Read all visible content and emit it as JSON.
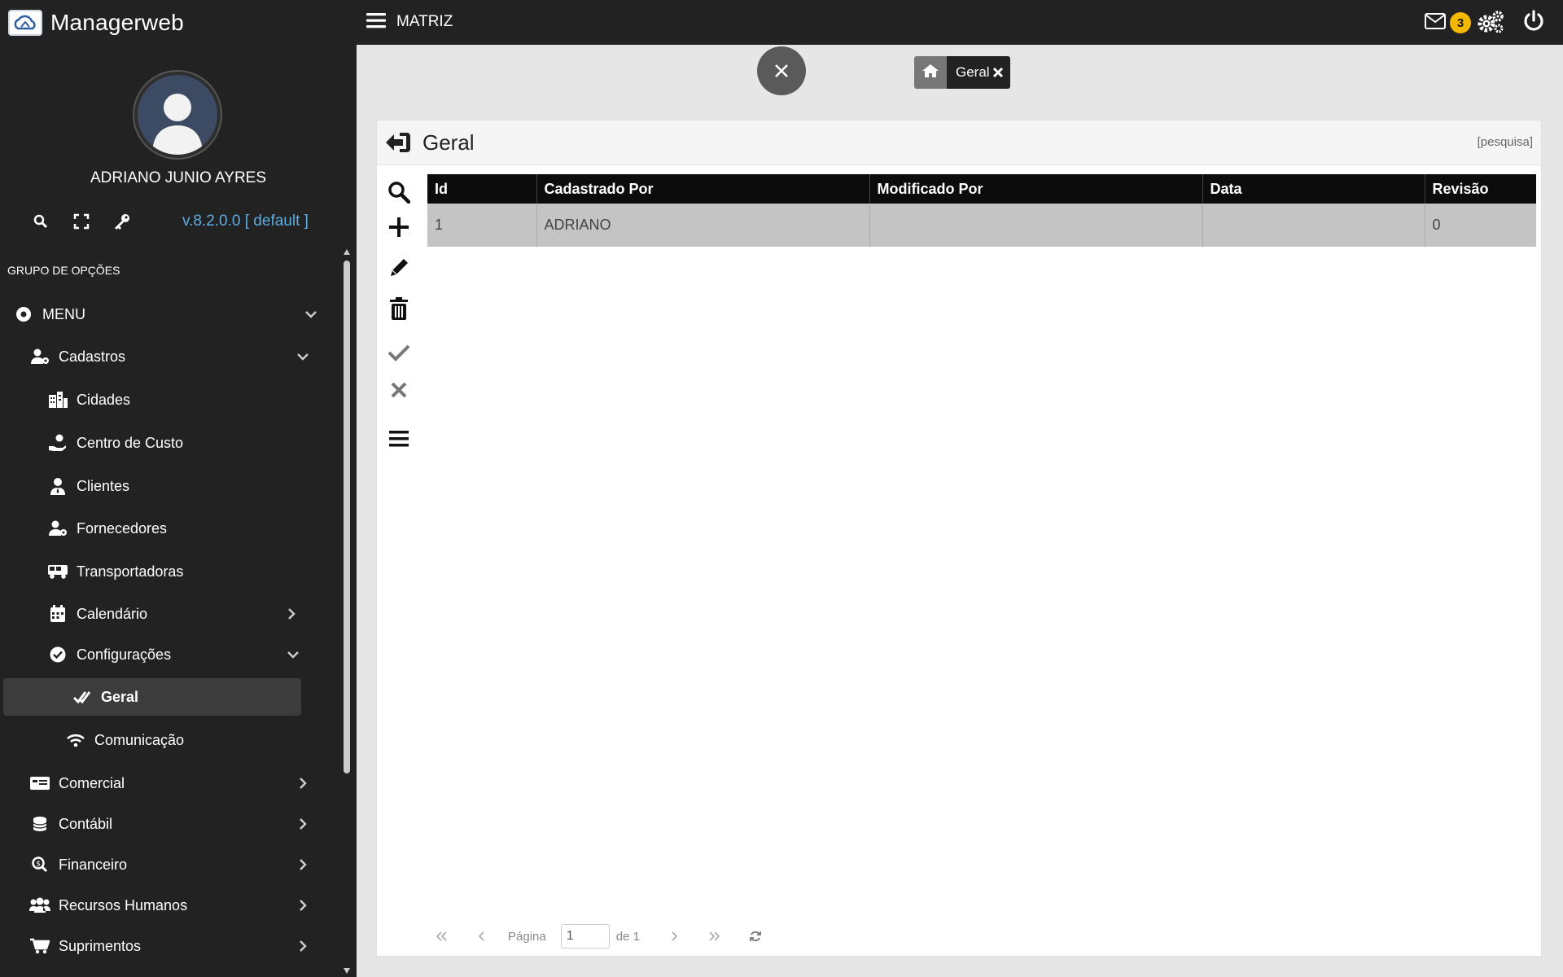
{
  "app": {
    "title": "Managerweb",
    "company": "MATRIZ",
    "version": "v.8.2.0.0 [ default ]"
  },
  "user": {
    "name": "ADRIANO JUNIO AYRES"
  },
  "notifications": {
    "mail_count": "3"
  },
  "sidebar": {
    "group_label": "GRUPO DE OPÇÕES",
    "items": [
      {
        "label": "MENU",
        "icon": "dot-circle-icon"
      },
      {
        "label": "Cadastros",
        "icon": "user-cog-icon"
      },
      {
        "label": "Cidades",
        "icon": "city-icon"
      },
      {
        "label": "Centro de Custo",
        "icon": "hand-holding-icon"
      },
      {
        "label": "Clientes",
        "icon": "user-tie-icon"
      },
      {
        "label": "Fornecedores",
        "icon": "user-cog-icon"
      },
      {
        "label": "Transportadoras",
        "icon": "truck-icon"
      },
      {
        "label": "Calendário",
        "icon": "calendar-icon"
      },
      {
        "label": "Configurações",
        "icon": "check-circle-icon"
      },
      {
        "label": "Geral",
        "icon": "double-check-icon"
      },
      {
        "label": "Comunicação",
        "icon": "wifi-icon"
      },
      {
        "label": "Comercial",
        "icon": "card-icon"
      },
      {
        "label": "Contábil",
        "icon": "coins-icon"
      },
      {
        "label": "Financeiro",
        "icon": "search-dollar-icon"
      },
      {
        "label": "Recursos Humanos",
        "icon": "users-icon"
      },
      {
        "label": "Suprimentos",
        "icon": "cart-icon"
      }
    ]
  },
  "tabs": [
    {
      "label": "Geral"
    }
  ],
  "panel": {
    "title": "Geral",
    "search_link": "[pesquisa]",
    "table": {
      "columns": [
        "Id",
        "Cadastrado Por",
        "Modificado Por",
        "Data",
        "Revisão"
      ],
      "rows": [
        [
          "1",
          "ADRIANO",
          "",
          "",
          "0"
        ]
      ]
    },
    "pager": {
      "page_label": "Página",
      "page_value": "1",
      "of_label": "de 1"
    }
  },
  "colors": {
    "sidebar_bg": "#222222",
    "badge": "#f5b800",
    "version_link": "#5dade2",
    "header_row": "#0c0c0c",
    "selected_row": "#c4c4c4"
  }
}
